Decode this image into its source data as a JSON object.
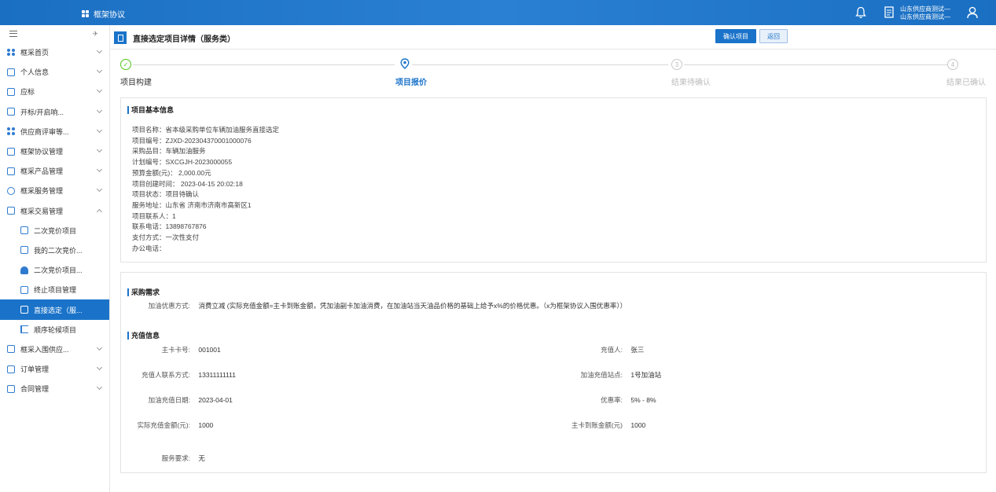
{
  "topbar": {
    "app_title": "框架协议",
    "user_line1": "山东供应商测试—",
    "user_line2": "山东供应商测试—",
    "icons": [
      "grid-icon",
      "bell-icon",
      "document-icon",
      "user-icon"
    ]
  },
  "sidebar": {
    "items": [
      {
        "label": "框采首页",
        "icon": "dots-icon"
      },
      {
        "label": "个人信息",
        "icon": "profile-icon"
      },
      {
        "label": "应标",
        "icon": "bid-icon"
      },
      {
        "label": "开标/开启响...",
        "icon": "open-bid-icon"
      },
      {
        "label": "供应商评审等...",
        "icon": "dots-icon"
      },
      {
        "label": "框架协议管理",
        "icon": "agreement-icon"
      },
      {
        "label": "框采产品管理",
        "icon": "product-icon"
      },
      {
        "label": "框采服务管理",
        "icon": "service-icon"
      },
      {
        "label": "框采交易管理",
        "icon": "trade-icon"
      },
      {
        "label": "框采入围供应...",
        "icon": "supplier-icon"
      },
      {
        "label": "订单管理",
        "icon": "order-icon"
      },
      {
        "label": "合同管理",
        "icon": "contract-icon"
      }
    ],
    "sub_items": [
      {
        "label": "二次竞价项目"
      },
      {
        "label": "我的二次竞价..."
      },
      {
        "label": "二次竞价项目..."
      },
      {
        "label": "终止项目管理"
      },
      {
        "label": "直接选定（服..."
      },
      {
        "label": "顺序轮候项目"
      }
    ]
  },
  "header": {
    "title": "直接选定项目详情（服务类）",
    "confirm_label": "确认项目",
    "back_label": "返回"
  },
  "steps": [
    {
      "label": "项目构建",
      "state": "done",
      "num": ""
    },
    {
      "label": "项目报价",
      "state": "current",
      "num": ""
    },
    {
      "label": "结果待确认",
      "state": "todo",
      "num": "3"
    },
    {
      "label": "结果已确认",
      "state": "todo",
      "num": "4"
    }
  ],
  "basic_info": {
    "title": "项目基本信息",
    "lines": [
      "项目名称：省本级采购单位车辆加油服务直接选定",
      "项目编号：ZJXD-202304370001000076",
      "采购品目：车辆加油服务",
      "计划编号：SXCGJH-2023000055",
      "预算金额(元)：  2,000.00元",
      "项目创建时间：  2023-04-15 20:02:18",
      "项目状态：项目待确认",
      "服务地址：山东省 济南市济南市高新区1",
      "项目联系人：1",
      "联系电话：13898767876",
      "支付方式：一次性支付",
      "办公电话："
    ]
  },
  "requirement": {
    "title": "采购需求",
    "discount_label": "加油优惠方式:",
    "discount_value": "消费立减 (实际充值金额=主卡到账金额，凭加油副卡加油消费，在加油站当天油品价格的基础上给予x%的价格优惠。（x为框架协议入围优惠率））"
  },
  "recharge": {
    "title": "充值信息",
    "main_card_label": "主卡卡号:",
    "main_card_value": "001001",
    "recharger_label": "充值人:",
    "recharger_value": "张三",
    "contact_label": "充值人联系方式:",
    "contact_value": "13311111111",
    "station_label": "加油充值站点:",
    "station_value": "1号加油站",
    "date_label": "加油充值日期:",
    "date_value": "2023-04-01",
    "rate_label": "优惠率:",
    "rate_value": "5% - 8%",
    "actual_label": "实际充值金额(元):",
    "actual_value": "1000",
    "arrived_label": "主卡到账金额(元)",
    "arrived_value": "1000",
    "service_label": "服务要求:",
    "service_value": "无"
  },
  "colors": {
    "primary": "#1a73c9",
    "done": "#52c41a",
    "todo": "#c8c8c8"
  }
}
